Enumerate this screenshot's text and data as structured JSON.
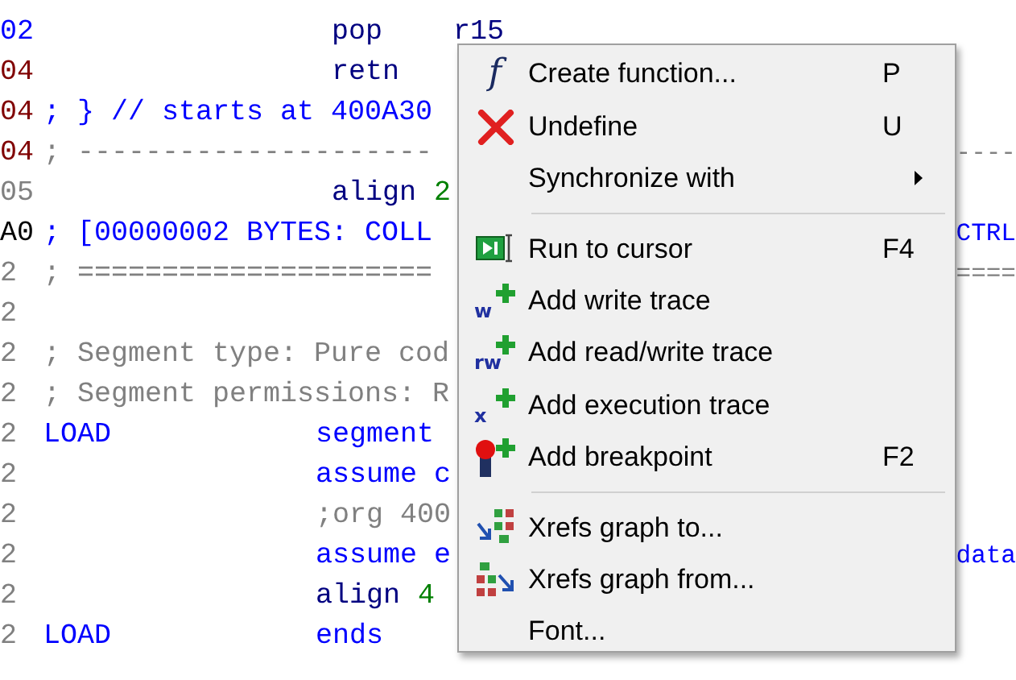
{
  "code_lines": [
    {
      "address": "02",
      "color": "#0000ff",
      "kind": "instr",
      "tokens": [
        {
          "kind": "mnemonic",
          "text": "pop"
        },
        {
          "kind": "operand",
          "text": "r15"
        }
      ]
    },
    {
      "address": "04",
      "color": "#800000",
      "kind": "instr",
      "tokens": [
        {
          "kind": "mnemonic",
          "text": "retn"
        }
      ]
    },
    {
      "address": "04",
      "color": "#800000",
      "kind": "comment",
      "tokens": [
        {
          "kind": "comment",
          "text": "; } // starts at 400A30"
        }
      ]
    },
    {
      "address": "04",
      "color": "#800000",
      "kind": "comment",
      "tokens": [
        {
          "kind": "grey",
          "text": "; ---------------------"
        }
      ],
      "tail": "----"
    },
    {
      "address": "05",
      "color": "#808080",
      "kind": "instr",
      "tokens": [
        {
          "kind": "mnemonic",
          "text": "align"
        },
        {
          "kind": "number",
          "text": "2"
        }
      ]
    },
    {
      "address": "A0",
      "color": "#000000",
      "kind": "comment",
      "tokens": [
        {
          "kind": "comment",
          "text": "; [00000002 BYTES: COLL"
        }
      ],
      "tail": "CTRL"
    },
    {
      "address": "2",
      "color": "#808080",
      "kind": "comment",
      "tokens": [
        {
          "kind": "grey",
          "text": "; ====================="
        }
      ],
      "tail": "===="
    },
    {
      "address": "2",
      "color": "#808080",
      "kind": "comment"
    },
    {
      "address": "2",
      "color": "#808080",
      "kind": "comment",
      "tokens": [
        {
          "kind": "grey",
          "text": "; Segment type: Pure cod"
        }
      ]
    },
    {
      "address": "2",
      "color": "#808080",
      "kind": "comment",
      "tokens": [
        {
          "kind": "grey",
          "text": "; Segment permissions: R"
        }
      ]
    },
    {
      "address": "2",
      "color": "#808080",
      "kind": "directive",
      "label": "LOAD",
      "tokens": [
        {
          "kind": "keyword",
          "text": "segment"
        }
      ]
    },
    {
      "address": "2",
      "color": "#808080",
      "kind": "directive",
      "tokens": [
        {
          "kind": "keyword",
          "text": "assume c"
        }
      ]
    },
    {
      "address": "2",
      "color": "#808080",
      "kind": "directive",
      "tokens": [
        {
          "kind": "grey",
          "text": ";org 400"
        }
      ]
    },
    {
      "address": "2",
      "color": "#808080",
      "kind": "directive",
      "tokens": [
        {
          "kind": "keyword",
          "text": "assume e"
        }
      ],
      "tail": "data"
    },
    {
      "address": "2",
      "color": "#808080",
      "kind": "directive",
      "tokens": [
        {
          "kind": "mnemonic",
          "text": "align"
        },
        {
          "kind": "number",
          "text": "4"
        }
      ]
    },
    {
      "address": "2",
      "color": "#808080",
      "kind": "directive",
      "label": "LOAD",
      "tokens": [
        {
          "kind": "keyword",
          "text": "ends"
        }
      ]
    }
  ],
  "context_menu": [
    {
      "kind": "function",
      "glyph": "f",
      "label": "Create function...",
      "shortcut": "P"
    },
    {
      "kind": "undefine",
      "label": "Undefine",
      "shortcut": "U"
    },
    {
      "kind": "submenu",
      "label": "Synchronize with"
    },
    {
      "kind": "separator"
    },
    {
      "kind": "run",
      "label": "Run to cursor",
      "shortcut": "F4"
    },
    {
      "kind": "trace",
      "glyph": "w",
      "label": "Add write trace"
    },
    {
      "kind": "trace",
      "glyph": "rw",
      "label": "Add read/write trace"
    },
    {
      "kind": "trace",
      "glyph": "x",
      "label": "Add execution trace"
    },
    {
      "kind": "breakpoint",
      "label": "Add breakpoint",
      "shortcut": "F2"
    },
    {
      "kind": "separator"
    },
    {
      "kind": "xrefs-to",
      "label": "Xrefs graph to..."
    },
    {
      "kind": "xrefs-from",
      "label": "Xrefs graph from..."
    },
    {
      "kind": "plain",
      "label": "Font..."
    }
  ]
}
